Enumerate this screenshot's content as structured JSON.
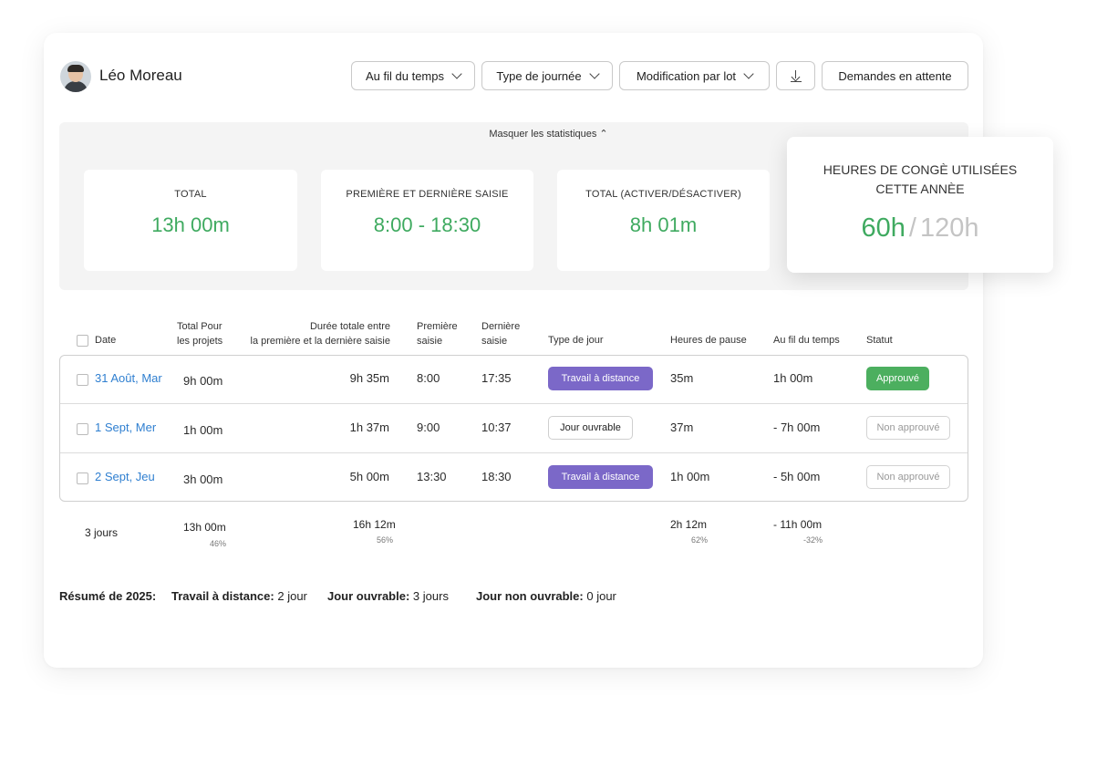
{
  "user": {
    "name": "Léo Moreau"
  },
  "toolbar": {
    "over_time": "Au fil du temps",
    "day_type": "Type de journée",
    "bulk_edit": "Modification par lot",
    "pending": "Demandes en attente"
  },
  "stats": {
    "toggle": "Masquer les statistiques",
    "total_label": "TOTAL",
    "total_value": "13h 00m",
    "first_last_label": "PREMIÈRE ET DERNIÈRE SAISIE",
    "first_last_value": "8:00 - 18:30",
    "toggle_total_label": "TOTAL (ACTIVER/DÉSACTIVER)",
    "toggle_total_value": "8h 01m",
    "leave_label": "HEURES DE CONGÈ UTILISÉES CETTE ANNÈE",
    "leave_used": "60h",
    "leave_sep": "/",
    "leave_total": "120h"
  },
  "columns": {
    "date": "Date",
    "projects_1": "Total Pour",
    "projects_2": "les projets",
    "duration_1": "Durée totale entre",
    "duration_2": "la première et la dernière saisie",
    "first_1": "Première",
    "first_2": "saisie",
    "last_1": "Dernière",
    "last_2": "saisie",
    "day_type": "Type de jour",
    "pause": "Heures de pause",
    "over_time": "Au fil du temps",
    "status": "Statut"
  },
  "rows": [
    {
      "date": "31 Août, Mar",
      "projects": "9h 00m",
      "duration": "9h 35m",
      "first": "8:00",
      "last": "17:35",
      "day_type": "Travail à distance",
      "pause": "35m",
      "over_time": "1h 00m",
      "status": "Approuvé"
    },
    {
      "date": "1 Sept, Mer",
      "projects": "1h 00m",
      "duration": "1h 37m",
      "first": "9:00",
      "last": "10:37",
      "day_type": "Jour ouvrable",
      "pause": "37m",
      "over_time": "- 7h 00m",
      "status": "Non approuvé"
    },
    {
      "date": "2 Sept, Jeu",
      "projects": "3h 00m",
      "duration": "5h 00m",
      "first": "13:30",
      "last": "18:30",
      "day_type": "Travail à distance",
      "pause": "1h 00m",
      "over_time": "- 5h 00m",
      "status": "Non approuvé"
    }
  ],
  "totals": {
    "days": "3 jours",
    "projects": "13h 00m",
    "projects_pct": "46%",
    "duration": "16h 12m",
    "duration_pct": "56%",
    "pause": "2h 12m",
    "pause_pct": "62%",
    "over_time": "- 11h 00m",
    "over_time_pct": "-32%"
  },
  "summary": {
    "label": "Résumé de 2025:",
    "remote_label": "Travail à distance:",
    "remote_value": "2 jour",
    "work_label": "Jour ouvrable:",
    "work_value": "3 jours",
    "nonwork_label": "Jour non ouvrable:",
    "nonwork_value": "0 jour"
  },
  "colors": {
    "accent_green": "#3faa60",
    "remote_purple": "#7b68c8",
    "link_blue": "#2f7fd0",
    "approved_green": "#4caf5f"
  }
}
